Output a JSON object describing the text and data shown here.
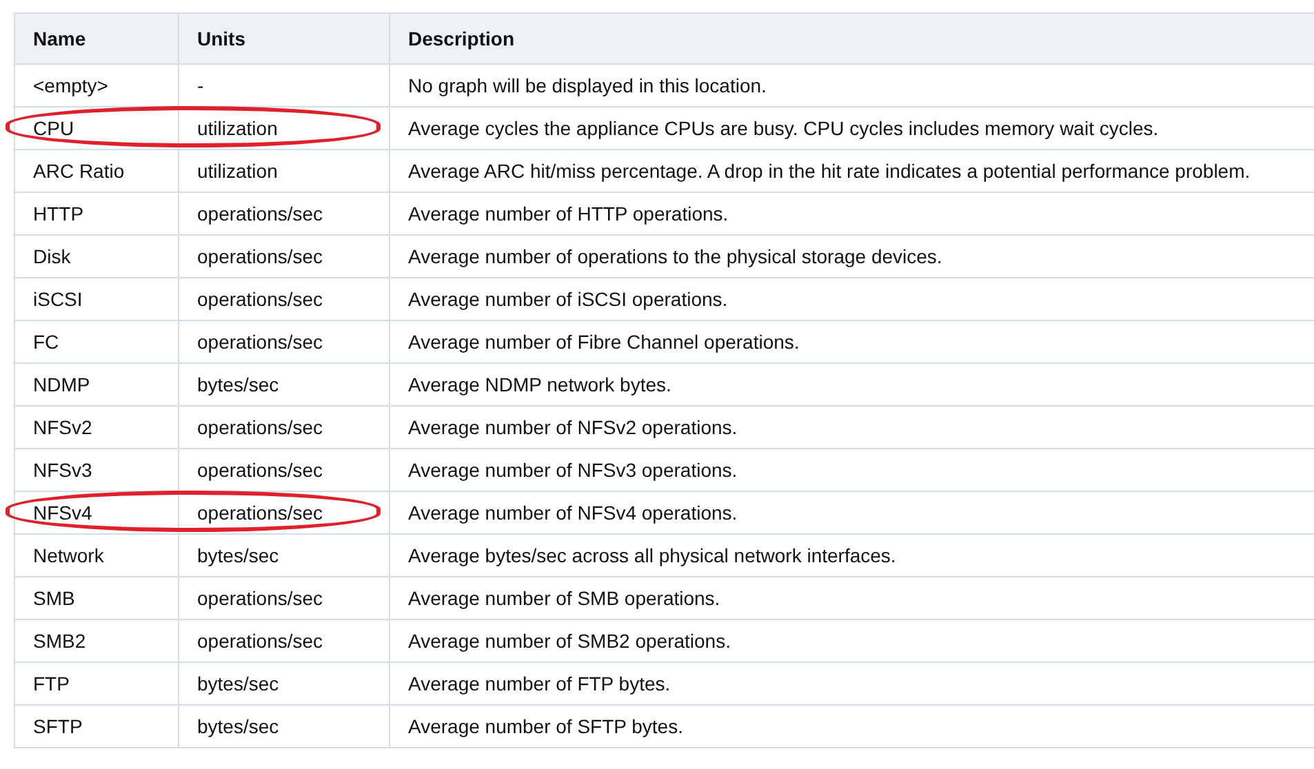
{
  "table": {
    "columns": [
      "Name",
      "Units",
      "Description"
    ],
    "rows": [
      {
        "name": "<empty>",
        "units": "-",
        "description": "No graph will be displayed in this location.",
        "highlighted": false
      },
      {
        "name": "CPU",
        "units": "utilization",
        "description": "Average cycles the appliance CPUs are busy. CPU cycles includes memory wait cycles.",
        "highlighted": true
      },
      {
        "name": "ARC Ratio",
        "units": "utilization",
        "description": "Average ARC hit/miss percentage. A drop in the hit rate indicates a potential performance problem.",
        "highlighted": false
      },
      {
        "name": "HTTP",
        "units": "operations/sec",
        "description": "Average number of HTTP operations.",
        "highlighted": false
      },
      {
        "name": "Disk",
        "units": "operations/sec",
        "description": "Average number of operations to the physical storage devices.",
        "highlighted": false
      },
      {
        "name": "iSCSI",
        "units": "operations/sec",
        "description": "Average number of iSCSI operations.",
        "highlighted": false
      },
      {
        "name": "FC",
        "units": "operations/sec",
        "description": "Average number of Fibre Channel operations.",
        "highlighted": false
      },
      {
        "name": "NDMP",
        "units": "bytes/sec",
        "description": "Average NDMP network bytes.",
        "highlighted": false
      },
      {
        "name": "NFSv2",
        "units": "operations/sec",
        "description": "Average number of NFSv2 operations.",
        "highlighted": false
      },
      {
        "name": "NFSv3",
        "units": "operations/sec",
        "description": "Average number of NFSv3 operations.",
        "highlighted": false
      },
      {
        "name": "NFSv4",
        "units": "operations/sec",
        "description": "Average number of NFSv4 operations.",
        "highlighted": true
      },
      {
        "name": "Network",
        "units": "bytes/sec",
        "description": "Average bytes/sec across all physical network interfaces.",
        "highlighted": false
      },
      {
        "name": "SMB",
        "units": "operations/sec",
        "description": "Average number of SMB operations.",
        "highlighted": false
      },
      {
        "name": "SMB2",
        "units": "operations/sec",
        "description": "Average number of SMB2 operations.",
        "highlighted": false
      },
      {
        "name": "FTP",
        "units": "bytes/sec",
        "description": "Average number of FTP bytes.",
        "highlighted": false
      },
      {
        "name": "SFTP",
        "units": "bytes/sec",
        "description": "Average number of SFTP bytes.",
        "highlighted": false
      }
    ]
  }
}
